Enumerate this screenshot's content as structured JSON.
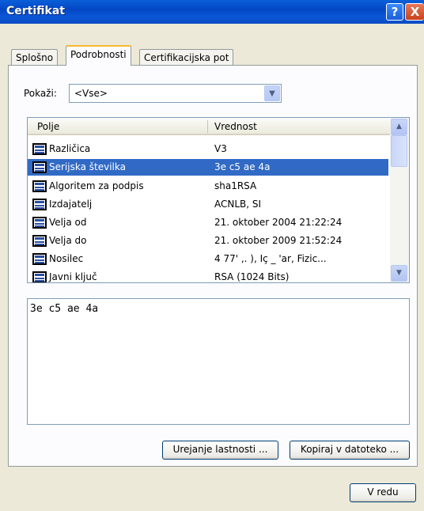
{
  "window": {
    "title": "Certifikat",
    "help_glyph": "?",
    "close_glyph": "X"
  },
  "tabs": [
    {
      "label": "Splošno",
      "active": false
    },
    {
      "label": "Podrobnosti",
      "active": true
    },
    {
      "label": "Certifikacijska pot",
      "active": false
    }
  ],
  "filter": {
    "label": "Pokaži:",
    "selected": "<Vse>"
  },
  "list": {
    "columns": [
      "Polje",
      "Vrednost"
    ],
    "rows": [
      {
        "field": "Različica",
        "value": "V3",
        "selected": false
      },
      {
        "field": "Serijska številka",
        "value": "3e c5 ae 4a",
        "selected": true
      },
      {
        "field": "Algoritem za podpis",
        "value": "sha1RSA",
        "selected": false
      },
      {
        "field": "Izdajatelj",
        "value": "ACNLB, SI",
        "selected": false
      },
      {
        "field": "Velja od",
        "value": "21. oktober 2004 21:22:24",
        "selected": false
      },
      {
        "field": "Velja do",
        "value": "21. oktober 2009 21:52:24",
        "selected": false
      },
      {
        "field": "Nosilec",
        "value": "4 77' ,. ), Iç _ 'ar, Fizic...",
        "selected": false
      },
      {
        "field": "Javni ključ",
        "value": "RSA (1024 Bits)",
        "selected": false
      }
    ]
  },
  "detail": {
    "text": "3e c5 ae 4a"
  },
  "buttons": {
    "edit_properties": "Urejanje lastnosti ...",
    "copy_to_file": "Kopiraj v datoteko ...",
    "ok": "V redu"
  },
  "colors": {
    "titlebar": "#0346c4",
    "selection": "#316ac5",
    "dialog_bg": "#ece9d8",
    "active_tab_accent": "#f8b830"
  }
}
